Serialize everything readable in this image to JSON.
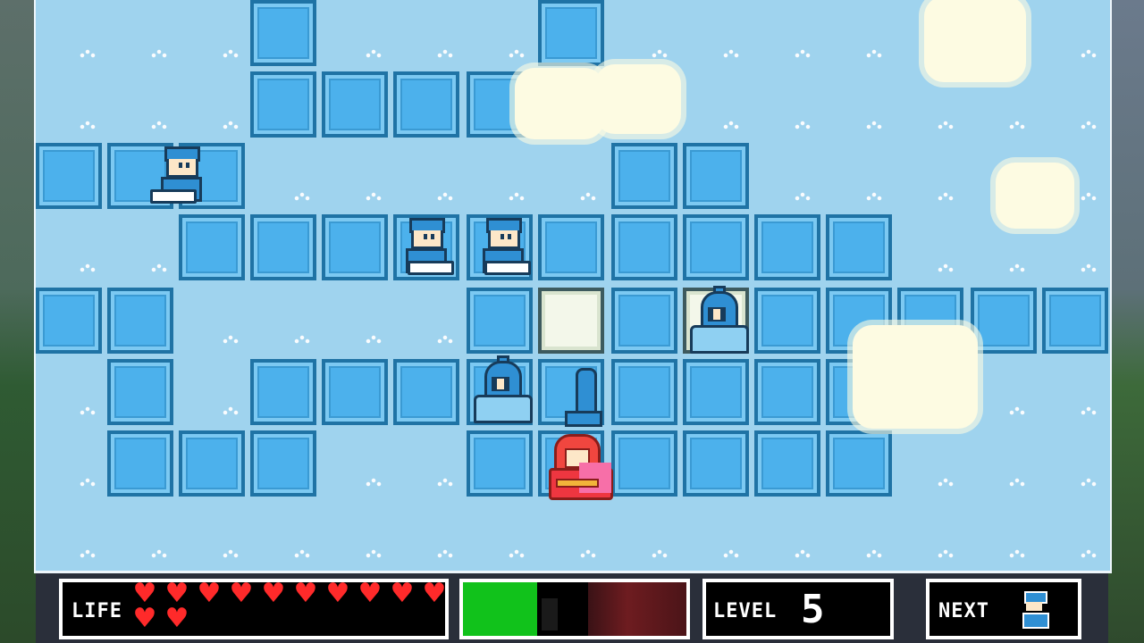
{
  "hud": {
    "life_label": "LIFE",
    "hearts": [
      "♥",
      "♥",
      "♥",
      "♥",
      "♥",
      "♥",
      "♥",
      "♥",
      "♥",
      "♥",
      "♥",
      "♥"
    ],
    "level_label": "LEVEL",
    "level_value": "5",
    "next_label": "NEXT",
    "next_piece": "soldier-icon",
    "gauge_level": 0.55
  },
  "colors": {
    "sky": "#9fd3ee",
    "tile": "#4cb1ec",
    "tile_border": "#1f73a5",
    "highlight_tile": "#f3f7ea",
    "heart": "#ff2a2a",
    "gauge": "#11c21b"
  }
}
